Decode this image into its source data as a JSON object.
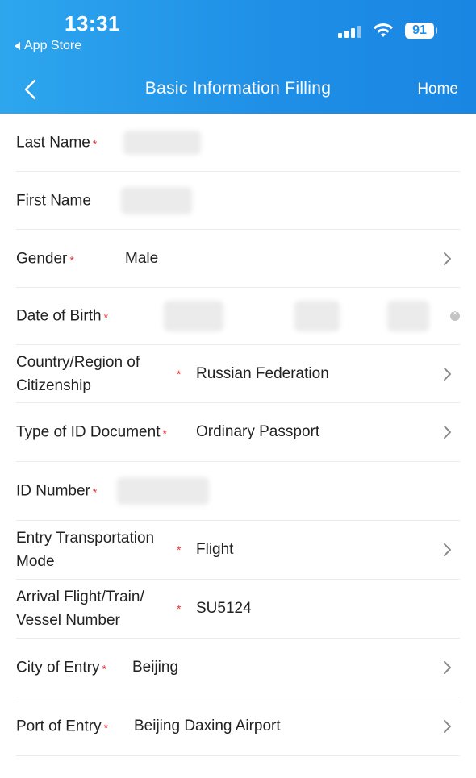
{
  "status_bar": {
    "time": "13:31",
    "back_app": "App Store",
    "battery": "91"
  },
  "nav": {
    "title": "Basic Information Filling",
    "home_label": "Home"
  },
  "required_mark": "*",
  "fields": {
    "last_name": {
      "label": "Last Name",
      "value": ""
    },
    "first_name": {
      "label": "First Name",
      "value": ""
    },
    "gender": {
      "label": "Gender",
      "value": "Male"
    },
    "dob": {
      "label": "Date of Birth",
      "value": ""
    },
    "citizenship": {
      "label_line1": "Country/Region of",
      "label_line2": "Citizenship",
      "value": "Russian Federation"
    },
    "id_type": {
      "label": "Type of ID Document",
      "value": "Ordinary Passport"
    },
    "id_number": {
      "label": "ID Number",
      "value": ""
    },
    "transport": {
      "label_line1": "Entry Transportation",
      "label_line2": "Mode",
      "value": "Flight"
    },
    "vessel": {
      "label_line1": "Arrival Flight/Train/",
      "label_line2": "Vessel Number",
      "value": "SU5124"
    },
    "city": {
      "label": "City of Entry",
      "value": "Beijing"
    },
    "port": {
      "label": "Port of Entry",
      "value": "Beijing Daxing Airport"
    }
  },
  "colors": {
    "header_blue": "#1e8ee6",
    "required_red": "#ee3333"
  }
}
